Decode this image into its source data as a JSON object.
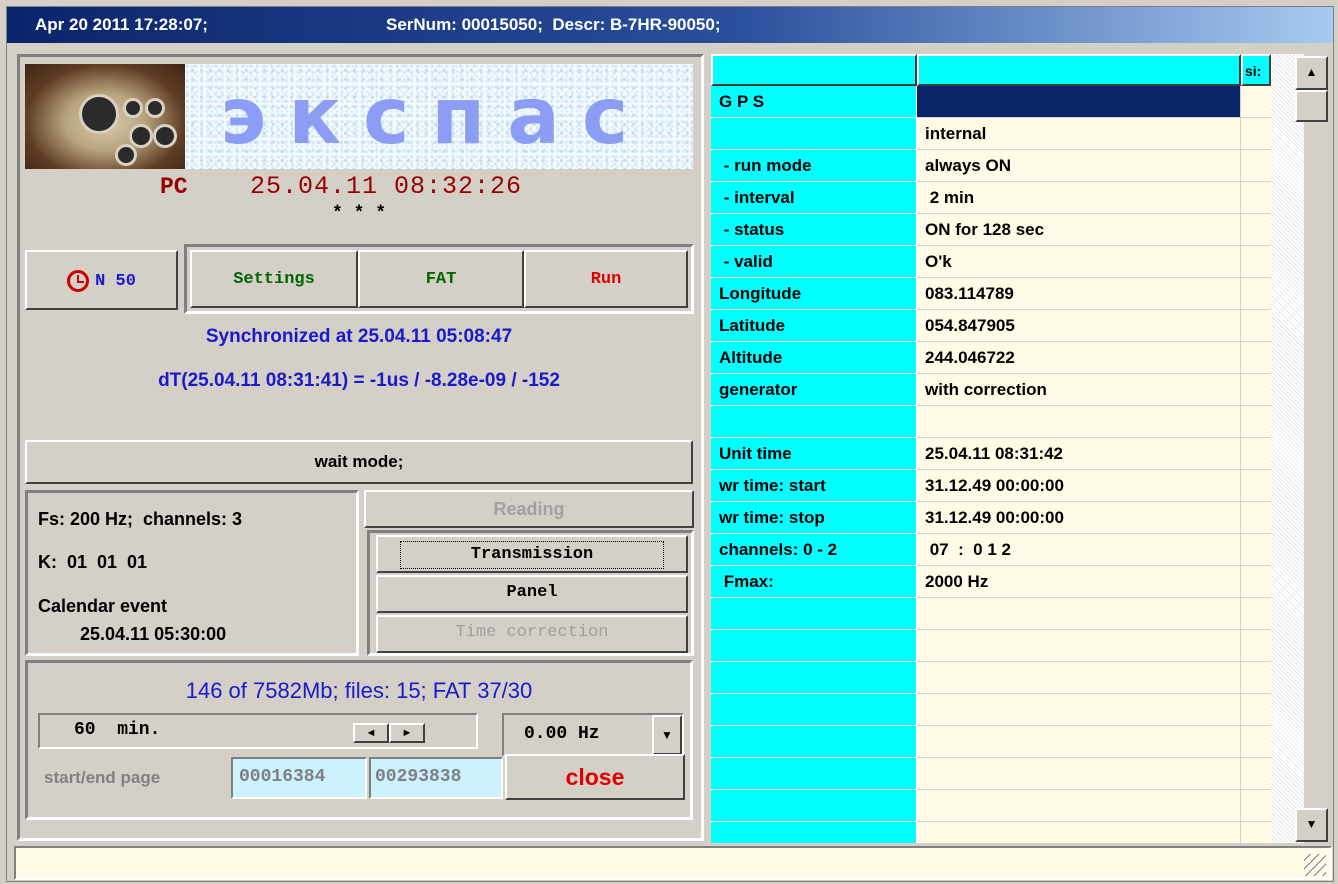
{
  "titlebar": {
    "datetime": "Apr 20 2011 17:28:07;",
    "serial": "SerNum: 00015050;  Descr: B-7HR-90050;"
  },
  "logo": {
    "text": "экспас"
  },
  "clock": {
    "label": "PC",
    "value": "25.04.11 08:32:26",
    "dots": "* * *"
  },
  "buttons": {
    "n_counter": "N 50",
    "settings": "Settings",
    "fat": "FAT",
    "run": "Run"
  },
  "sync": {
    "synchronized": "Synchronized at 25.04.11 05:08:47",
    "dt": "dT(25.04.11 08:31:41) = -1us / -8.28e-09 / -152"
  },
  "mode": "wait mode;",
  "info": {
    "fs": "Fs: 200 Hz;  channels: 3",
    "k": "K:  01  01  01",
    "calendar_label": "Calendar event",
    "calendar_value": "25.04.11 05:30:00"
  },
  "actions": {
    "reading": "Reading",
    "transmission": "Transmission",
    "panel": "Panel",
    "time_correction": "Time correction"
  },
  "storage": {
    "summary": "146 of 7582Mb; files: 15;  FAT 37/30",
    "duration": "60  min.",
    "frequency": "0.00 Hz",
    "page_label": "start/end page",
    "start_page": "00016384",
    "end_page": "00293838",
    "close": "close"
  },
  "grid": {
    "header_extra": "si:",
    "rows": [
      {
        "label": "G P S",
        "value": ""
      },
      {
        "label": "",
        "value": "internal"
      },
      {
        "label": " - run mode",
        "value": "always ON"
      },
      {
        "label": " - interval",
        "value": " 2 min"
      },
      {
        "label": " - status",
        "value": "ON for 128 sec"
      },
      {
        "label": " - valid",
        "value": "O'k"
      },
      {
        "label": "Longitude",
        "value": "083.114789"
      },
      {
        "label": "Latitude",
        "value": "054.847905"
      },
      {
        "label": "Altitude",
        "value": "244.046722"
      },
      {
        "label": "generator",
        "value": "with correction"
      },
      {
        "label": "",
        "value": ""
      },
      {
        "label": "Unit time",
        "value": "25.04.11 08:31:42"
      },
      {
        "label": "wr time: start",
        "value": "31.12.49 00:00:00"
      },
      {
        "label": "wr time: stop",
        "value": "31.12.49 00:00:00"
      },
      {
        "label": "channels: 0 - 2",
        "value": " 07  :  0 1 2"
      },
      {
        "label": " Fmax:",
        "value": "2000 Hz"
      },
      {
        "label": "",
        "value": ""
      },
      {
        "label": "",
        "value": ""
      },
      {
        "label": "",
        "value": ""
      },
      {
        "label": "",
        "value": ""
      },
      {
        "label": "",
        "value": ""
      },
      {
        "label": "",
        "value": ""
      },
      {
        "label": "",
        "value": ""
      },
      {
        "label": "",
        "value": ""
      }
    ]
  },
  "colors": {
    "title_dark": "#0a246a",
    "accent_blue": "#1a1acc",
    "dark_red": "#990000",
    "green": "#006600",
    "red": "#e00000",
    "cyan": "#00ffff",
    "cream": "#fffbe6",
    "selected": "#0a246a"
  }
}
